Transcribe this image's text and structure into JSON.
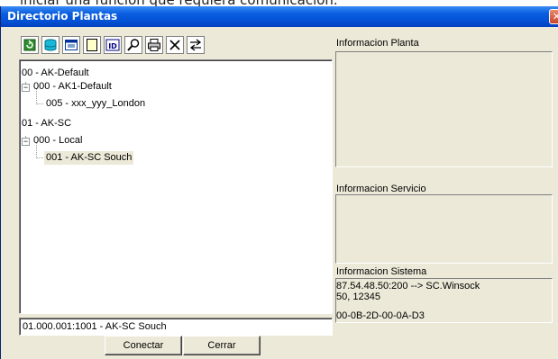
{
  "background": {
    "clipped_text": "iniciar una función que requiera comunicación."
  },
  "window": {
    "title": "Directorio Plantas",
    "close_glyph": "✕"
  },
  "toolbar": {
    "buttons": [
      {
        "icon": "refresh-icon"
      },
      {
        "icon": "database-icon"
      },
      {
        "icon": "window-icon"
      },
      {
        "icon": "blank-page-icon"
      },
      {
        "icon": "id-icon"
      },
      {
        "icon": "search-icon"
      },
      {
        "icon": "print-icon"
      },
      {
        "icon": "delete-icon"
      },
      {
        "icon": "transfer-icon"
      }
    ],
    "id_text": "ID"
  },
  "tree": {
    "nodes": [
      {
        "label": "00 - AK-Default"
      },
      {
        "label": "000 - AK1-Default",
        "expander": "−"
      },
      {
        "label": "005 - xxx_yyy_London"
      },
      {
        "label": "01 - AK-SC"
      },
      {
        "label": "000 - Local",
        "expander": "−"
      },
      {
        "label": "001 - AK-SC Souch",
        "selected": true
      }
    ]
  },
  "selection": {
    "value": "01.000.001:1001 - AK-SC Souch"
  },
  "buttons": {
    "connect": "Conectar",
    "close": "Cerrar"
  },
  "info": {
    "planta_label": "Informacion Planta",
    "servicio_label": "Informacion Servicio",
    "sistema_label": "Informacion Sistema",
    "sistema_lines": [
      "87.54.48.50:200 --> SC.Winsock",
      "50, 12345",
      "00-0B-2D-00-0A-D3"
    ]
  },
  "colors": {
    "titlebar": "#0452d6",
    "dialog_bg": "#ece9d8",
    "close_button": "#c8452a"
  }
}
